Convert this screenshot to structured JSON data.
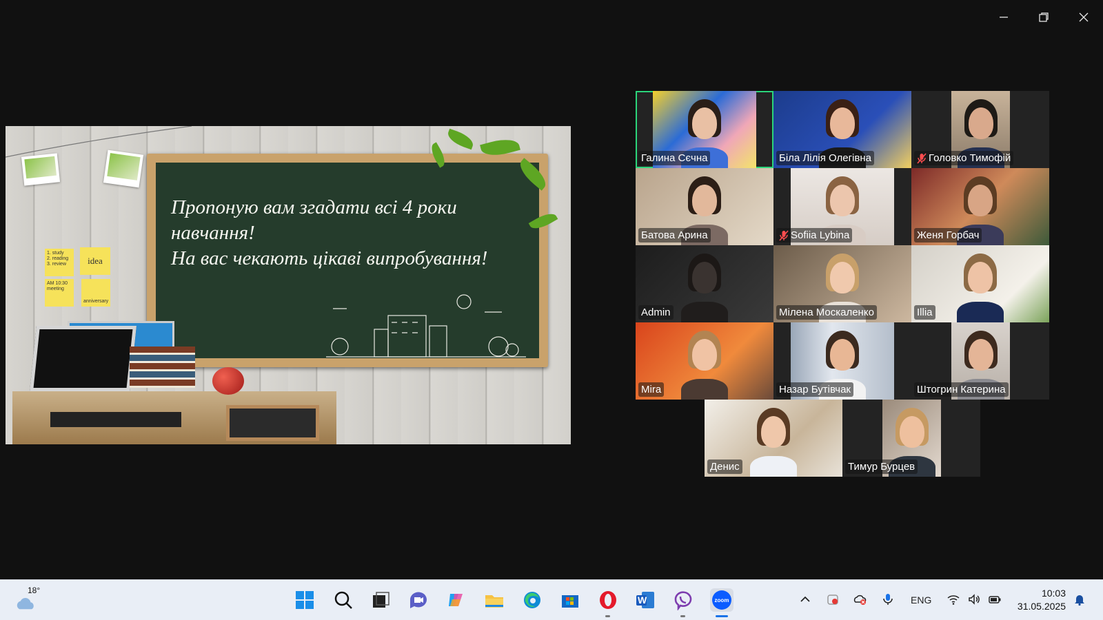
{
  "window": {
    "controls": {
      "minimize": "minimize-icon",
      "maximize": "restore-icon",
      "close": "close-icon"
    }
  },
  "slide": {
    "lines": [
      "Пропоную вам згадати всі 4 роки",
      "навчання!",
      "На вас чекають цікаві випробування!"
    ],
    "notes": {
      "note1": [
        "1. study",
        "2. reading",
        "3. review"
      ],
      "note2": "idea",
      "note3": [
        "AM 10:30",
        "meeting"
      ],
      "note4": "anniversary"
    }
  },
  "gallery": {
    "active_speaker_color": "#2bd67b",
    "participants": [
      {
        "name": "Галина Сєчна",
        "muted": false,
        "speaking": true
      },
      {
        "name": "Біла Лілія Олегівна",
        "muted": false,
        "speaking": false
      },
      {
        "name": "Головко Тимофій",
        "muted": true,
        "speaking": false
      },
      {
        "name": "Батова Арина",
        "muted": false,
        "speaking": false
      },
      {
        "name": "Sofiia Lybina",
        "muted": true,
        "speaking": false
      },
      {
        "name": "Женя Горбач",
        "muted": false,
        "speaking": false
      },
      {
        "name": "Admin",
        "muted": false,
        "speaking": false
      },
      {
        "name": "Мілена Москаленко",
        "muted": false,
        "speaking": false
      },
      {
        "name": "Illia",
        "muted": false,
        "speaking": false
      },
      {
        "name": "Mira",
        "muted": false,
        "speaking": false
      },
      {
        "name": "Назар Бутівчак",
        "muted": false,
        "speaking": false
      },
      {
        "name": "Штогрин Катерина",
        "muted": false,
        "speaking": false
      },
      {
        "name": "Денис",
        "muted": false,
        "speaking": false
      },
      {
        "name": "Тимур Бурцев",
        "muted": false,
        "speaking": false
      }
    ]
  },
  "taskbar": {
    "weather": {
      "temp": "18°",
      "icon": "cloud-icon"
    },
    "apps": [
      {
        "name": "start",
        "icon": "windows-logo-icon"
      },
      {
        "name": "search",
        "icon": "search-icon"
      },
      {
        "name": "task-view",
        "icon": "task-view-icon"
      },
      {
        "name": "meet",
        "icon": "video-chat-icon"
      },
      {
        "name": "copilot",
        "icon": "copilot-icon"
      },
      {
        "name": "file-explorer",
        "icon": "folder-icon"
      },
      {
        "name": "edge",
        "icon": "edge-icon"
      },
      {
        "name": "store",
        "icon": "store-icon"
      },
      {
        "name": "opera",
        "icon": "opera-icon"
      },
      {
        "name": "word",
        "icon": "word-icon"
      },
      {
        "name": "viber",
        "icon": "viber-icon"
      },
      {
        "name": "zoom",
        "icon": "zoom-icon"
      }
    ],
    "zoom_label": "zoom",
    "word_letter": "W",
    "tray": {
      "language": "ENG",
      "time": "10:03",
      "date": "31.05.2025"
    }
  }
}
